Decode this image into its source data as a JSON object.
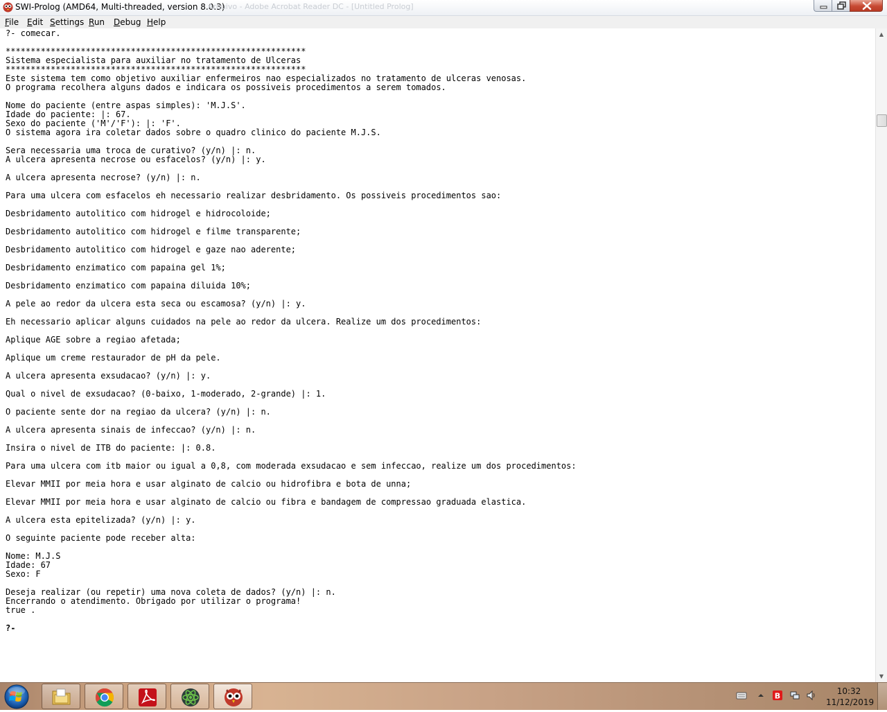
{
  "window": {
    "title": "SWI-Prolog (AMD64, Multi-threaded, version 8.0.3)",
    "background_title": "Arquivo - Adobe Acrobat Reader DC - [Untitled Prolog]"
  },
  "menu": [
    {
      "label": "File",
      "accel": "F",
      "rest": "ile"
    },
    {
      "label": "Edit",
      "accel": "E",
      "rest": "dit"
    },
    {
      "label": "Settings",
      "accel": "S",
      "rest": "ettings"
    },
    {
      "label": "Run",
      "accel": "R",
      "rest": "un"
    },
    {
      "label": "Debug",
      "accel": "D",
      "rest": "ebug"
    },
    {
      "label": "Help",
      "accel": "H",
      "rest": "elp"
    }
  ],
  "console": {
    "lines": [
      "?- comecar.",
      "",
      "************************************************************",
      "Sistema especialista para auxiliar no tratamento de Ulceras",
      "************************************************************",
      "Este sistema tem como objetivo auxiliar enfermeiros nao especializados no tratamento de ulceras venosas.",
      "O programa recolhera alguns dados e indicara os possiveis procedimentos a serem tomados.",
      "",
      "Nome do paciente (entre aspas simples): 'M.J.S'.",
      "Idade do paciente: |: 67.",
      "Sexo do paciente ('M'/'F'): |: 'F'.",
      "O sistema agora ira coletar dados sobre o quadro clinico do paciente M.J.S.",
      "",
      "Sera necessaria uma troca de curativo? (y/n) |: n.",
      "A ulcera apresenta necrose ou esfacelos? (y/n) |: y.",
      "",
      "A ulcera apresenta necrose? (y/n) |: n.",
      "",
      "Para uma ulcera com esfacelos eh necessario realizar desbridamento. Os possiveis procedimentos sao:",
      "",
      "Desbridamento autolitico com hidrogel e hidrocoloide;",
      "",
      "Desbridamento autolitico com hidrogel e filme transparente;",
      "",
      "Desbridamento autolitico com hidrogel e gaze nao aderente;",
      "",
      "Desbridamento enzimatico com papaina gel 1%;",
      "",
      "Desbridamento enzimatico com papaina diluida 10%;",
      "",
      "A pele ao redor da ulcera esta seca ou escamosa? (y/n) |: y.",
      "",
      "Eh necessario aplicar alguns cuidados na pele ao redor da ulcera. Realize um dos procedimentos:",
      "",
      "Aplique AGE sobre a regiao afetada;",
      "",
      "Aplique um creme restaurador de pH da pele.",
      "",
      "A ulcera apresenta exsudacao? (y/n) |: y.",
      "",
      "Qual o nivel de exsudacao? (0-baixo, 1-moderado, 2-grande) |: 1.",
      "",
      "O paciente sente dor na regiao da ulcera? (y/n) |: n.",
      "",
      "A ulcera apresenta sinais de infeccao? (y/n) |: n.",
      "",
      "Insira o nivel de ITB do paciente: |: 0.8.",
      "",
      "Para uma ulcera com itb maior ou igual a 0,8, com moderada exsudacao e sem infeccao, realize um dos procedimentos:",
      "",
      "Elevar MMII por meia hora e usar alginato de calcio ou hidrofibra e bota de unna;",
      "",
      "Elevar MMII por meia hora e usar alginato de calcio ou fibra e bandagem de compressao graduada elastica.",
      "",
      "A ulcera esta epitelizada? (y/n) |: y.",
      "",
      "O seguinte paciente pode receber alta:",
      "",
      "Nome: M.J.S",
      "Idade: 67",
      "Sexo: F",
      "",
      "Deseja realizar (ou repetir) uma nova coleta de dados? (y/n) |: n.",
      "Encerrando o atendimento. Obrigado por utilizar o programa!",
      "true .",
      "",
      "?-"
    ],
    "bold_line_index": 66
  },
  "taskbar": {
    "apps": [
      {
        "name": "file-explorer"
      },
      {
        "name": "chrome"
      },
      {
        "name": "adobe-acrobat-reader"
      },
      {
        "name": "atom"
      },
      {
        "name": "swi-prolog"
      }
    ],
    "clock": {
      "time": "10:32",
      "date": "11/12/2019"
    }
  },
  "colors": {
    "close_button": "#c84a34",
    "taskbar_bg": "#c9a07e",
    "acrobat_red": "#c4121a",
    "atom_green": "#6cc04a",
    "bitdefender_red": "#e01a1a"
  }
}
